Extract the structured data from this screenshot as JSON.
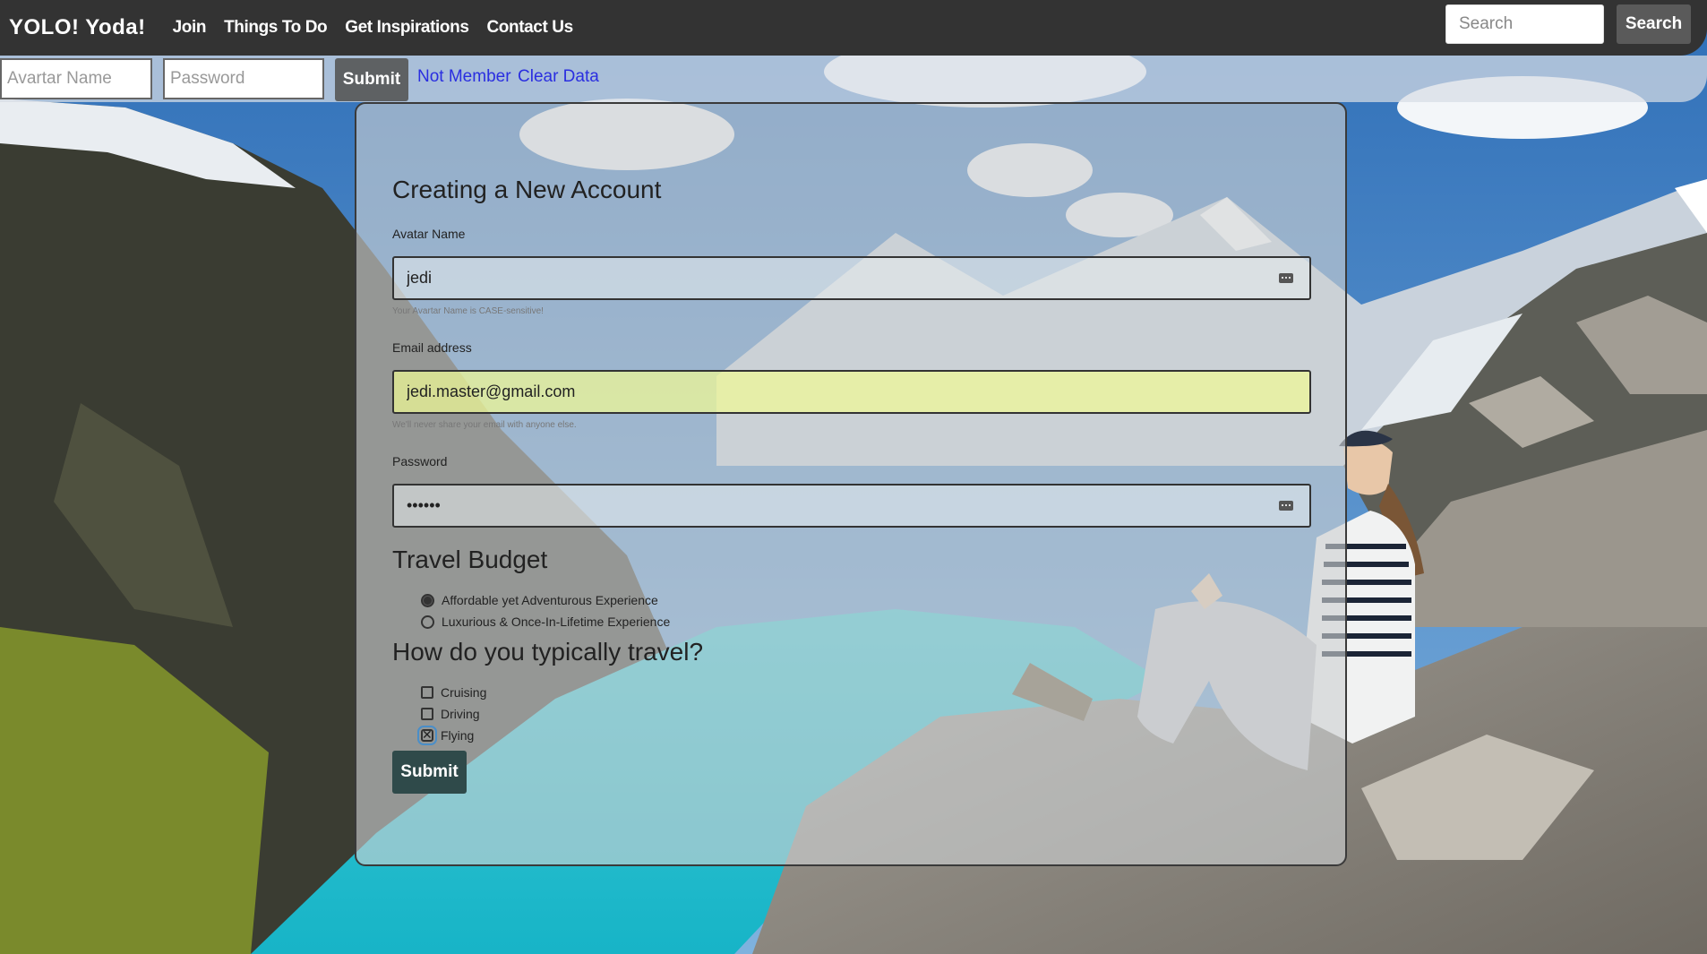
{
  "navbar": {
    "brand": "YOLO! Yoda!",
    "links": [
      "Join",
      "Things To Do",
      "Get Inspirations",
      "Contact Us"
    ],
    "search_placeholder": "Search",
    "search_button": "Search"
  },
  "login": {
    "avatar_placeholder": "Avartar Name",
    "password_placeholder": "Password",
    "submit_label": "Submit",
    "links": [
      "Not Member",
      "Clear Data"
    ]
  },
  "form": {
    "title": "Creating a New Account",
    "avatar": {
      "label": "Avatar Name",
      "value": "jedi",
      "help": "Your Avartar Name is CASE-sensitive!"
    },
    "email": {
      "label": "Email address",
      "value": "jedi.master@gmail.com",
      "help": "We'll never share your email with anyone else."
    },
    "password": {
      "label": "Password",
      "value": "••••••"
    },
    "budget": {
      "title": "Travel Budget",
      "options": [
        {
          "label": "Affordable yet Adventurous Experience",
          "checked": true
        },
        {
          "label": "Luxurious & Once-In-Lifetime Experience",
          "checked": false
        }
      ]
    },
    "travel": {
      "title": "How do you typically travel?",
      "options": [
        {
          "label": "Cruising",
          "checked": false
        },
        {
          "label": "Driving",
          "checked": false
        },
        {
          "label": "Flying",
          "checked": true
        }
      ]
    },
    "submit_label": "Submit"
  },
  "colors": {
    "navbar_bg": "#333333",
    "link_blue": "#2a2ee0",
    "submit_dark": "#2f4a4a",
    "lake": "#28c2d2",
    "sky": "#3f82c8"
  },
  "icons": [
    "keyboard-icon",
    "mountain-background-image"
  ]
}
